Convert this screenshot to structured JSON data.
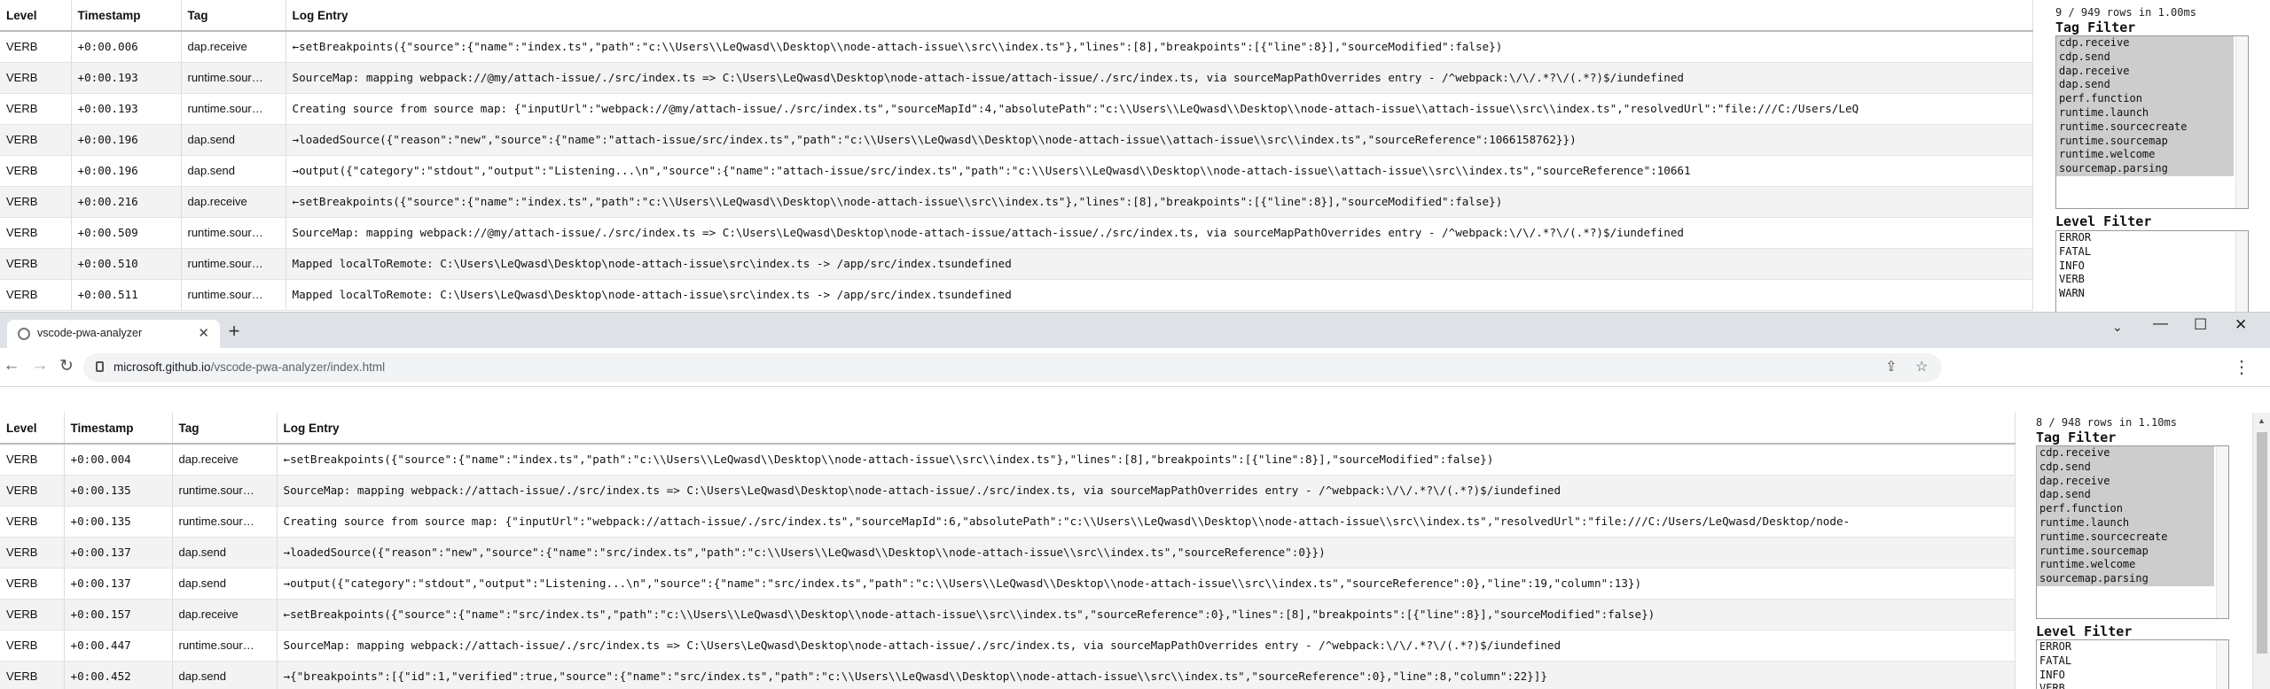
{
  "columns": [
    "Level",
    "Timestamp",
    "Tag",
    "Log Entry"
  ],
  "top": {
    "row_count": "9 / 949 rows in 1.00ms",
    "tag_filter_title": "Tag Filter",
    "tag_options": [
      "cdp.receive",
      "cdp.send",
      "dap.receive",
      "dap.send",
      "perf.function",
      "runtime.launch",
      "runtime.sourcecreate",
      "runtime.sourcemap",
      "runtime.welcome",
      "sourcemap.parsing"
    ],
    "level_filter_title": "Level Filter",
    "level_options": [
      "ERROR",
      "FATAL",
      "INFO",
      "VERB",
      "WARN"
    ],
    "rows": [
      {
        "level": "VERB",
        "ts": "+0:00.006",
        "tag": "dap.receive",
        "entry": "←setBreakpoints({\"source\":{\"name\":\"index.ts\",\"path\":\"c:\\\\Users\\\\LeQwasd\\\\Desktop\\\\node-attach-issue\\\\src\\\\index.ts\"},\"lines\":[8],\"breakpoints\":[{\"line\":8}],\"sourceModified\":false})"
      },
      {
        "level": "VERB",
        "ts": "+0:00.193",
        "tag": "runtime.sour…",
        "entry": "SourceMap: mapping webpack://@my/attach-issue/./src/index.ts => C:\\Users\\LeQwasd\\Desktop\\node-attach-issue/attach-issue/./src/index.ts, via sourceMapPathOverrides entry - /^webpack:\\/\\/.*?\\/(.*?)$/iundefined"
      },
      {
        "level": "VERB",
        "ts": "+0:00.193",
        "tag": "runtime.sour…",
        "entry": "Creating source from source map: {\"inputUrl\":\"webpack://@my/attach-issue/./src/index.ts\",\"sourceMapId\":4,\"absolutePath\":\"c:\\\\Users\\\\LeQwasd\\\\Desktop\\\\node-attach-issue\\\\attach-issue\\\\src\\\\index.ts\",\"resolvedUrl\":\"file:///C:/Users/LeQ"
      },
      {
        "level": "VERB",
        "ts": "+0:00.196",
        "tag": "dap.send",
        "entry": "→loadedSource({\"reason\":\"new\",\"source\":{\"name\":\"attach-issue/src/index.ts\",\"path\":\"c:\\\\Users\\\\LeQwasd\\\\Desktop\\\\node-attach-issue\\\\attach-issue\\\\src\\\\index.ts\",\"sourceReference\":1066158762}})"
      },
      {
        "level": "VERB",
        "ts": "+0:00.196",
        "tag": "dap.send",
        "entry": "→output({\"category\":\"stdout\",\"output\":\"Listening...\\n\",\"source\":{\"name\":\"attach-issue/src/index.ts\",\"path\":\"c:\\\\Users\\\\LeQwasd\\\\Desktop\\\\node-attach-issue\\\\attach-issue\\\\src\\\\index.ts\",\"sourceReference\":10661"
      },
      {
        "level": "VERB",
        "ts": "+0:00.216",
        "tag": "dap.receive",
        "entry": "←setBreakpoints({\"source\":{\"name\":\"index.ts\",\"path\":\"c:\\\\Users\\\\LeQwasd\\\\Desktop\\\\node-attach-issue\\\\src\\\\index.ts\"},\"lines\":[8],\"breakpoints\":[{\"line\":8}],\"sourceModified\":false})"
      },
      {
        "level": "VERB",
        "ts": "+0:00.509",
        "tag": "runtime.sour…",
        "entry": "SourceMap: mapping webpack://@my/attach-issue/./src/index.ts => C:\\Users\\LeQwasd\\Desktop\\node-attach-issue/attach-issue/./src/index.ts, via sourceMapPathOverrides entry - /^webpack:\\/\\/.*?\\/(.*?)$/iundefined"
      },
      {
        "level": "VERB",
        "ts": "+0:00.510",
        "tag": "runtime.sour…",
        "entry": "Mapped localToRemote: C:\\Users\\LeQwasd\\Desktop\\node-attach-issue\\src\\index.ts -> /app/src/index.tsundefined"
      },
      {
        "level": "VERB",
        "ts": "+0:00.511",
        "tag": "runtime.sour…",
        "entry": "Mapped localToRemote: C:\\Users\\LeQwasd\\Desktop\\node-attach-issue\\src\\index.ts -> /app/src/index.tsundefined"
      }
    ]
  },
  "browser": {
    "tab_title": "vscode-pwa-analyzer",
    "url_host": "microsoft.github.io",
    "url_path": "/vscode-pwa-analyzer/index.html"
  },
  "bottom": {
    "row_count": "8 / 948 rows in 1.10ms",
    "tag_filter_title": "Tag Filter",
    "tag_options": [
      "cdp.receive",
      "cdp.send",
      "dap.receive",
      "dap.send",
      "perf.function",
      "runtime.launch",
      "runtime.sourcecreate",
      "runtime.sourcemap",
      "runtime.welcome",
      "sourcemap.parsing"
    ],
    "level_filter_title": "Level Filter",
    "level_options": [
      "ERROR",
      "FATAL",
      "INFO",
      "VERB"
    ],
    "rows": [
      {
        "level": "VERB",
        "ts": "+0:00.004",
        "tag": "dap.receive",
        "entry": "←setBreakpoints({\"source\":{\"name\":\"index.ts\",\"path\":\"c:\\\\Users\\\\LeQwasd\\\\Desktop\\\\node-attach-issue\\\\src\\\\index.ts\"},\"lines\":[8],\"breakpoints\":[{\"line\":8}],\"sourceModified\":false})"
      },
      {
        "level": "VERB",
        "ts": "+0:00.135",
        "tag": "runtime.sour…",
        "entry": "SourceMap: mapping webpack://attach-issue/./src/index.ts => C:\\Users\\LeQwasd\\Desktop\\node-attach-issue/./src/index.ts, via sourceMapPathOverrides entry - /^webpack:\\/\\/.*?\\/(.*?)$/iundefined"
      },
      {
        "level": "VERB",
        "ts": "+0:00.135",
        "tag": "runtime.sour…",
        "entry": "Creating source from source map: {\"inputUrl\":\"webpack://attach-issue/./src/index.ts\",\"sourceMapId\":6,\"absolutePath\":\"c:\\\\Users\\\\LeQwasd\\\\Desktop\\\\node-attach-issue\\\\src\\\\index.ts\",\"resolvedUrl\":\"file:///C:/Users/LeQwasd/Desktop/node-"
      },
      {
        "level": "VERB",
        "ts": "+0:00.137",
        "tag": "dap.send",
        "entry": "→loadedSource({\"reason\":\"new\",\"source\":{\"name\":\"src/index.ts\",\"path\":\"c:\\\\Users\\\\LeQwasd\\\\Desktop\\\\node-attach-issue\\\\src\\\\index.ts\",\"sourceReference\":0}})"
      },
      {
        "level": "VERB",
        "ts": "+0:00.137",
        "tag": "dap.send",
        "entry": "→output({\"category\":\"stdout\",\"output\":\"Listening...\\n\",\"source\":{\"name\":\"src/index.ts\",\"path\":\"c:\\\\Users\\\\LeQwasd\\\\Desktop\\\\node-attach-issue\\\\src\\\\index.ts\",\"sourceReference\":0},\"line\":19,\"column\":13})"
      },
      {
        "level": "VERB",
        "ts": "+0:00.157",
        "tag": "dap.receive",
        "entry": "←setBreakpoints({\"source\":{\"name\":\"src/index.ts\",\"path\":\"c:\\\\Users\\\\LeQwasd\\\\Desktop\\\\node-attach-issue\\\\src\\\\index.ts\",\"sourceReference\":0},\"lines\":[8],\"breakpoints\":[{\"line\":8}],\"sourceModified\":false})"
      },
      {
        "level": "VERB",
        "ts": "+0:00.447",
        "tag": "runtime.sour…",
        "entry": "SourceMap: mapping webpack://attach-issue/./src/index.ts => C:\\Users\\LeQwasd\\Desktop\\node-attach-issue/./src/index.ts, via sourceMapPathOverrides entry - /^webpack:\\/\\/.*?\\/(.*?)$/iundefined"
      },
      {
        "level": "VERB",
        "ts": "+0:00.452",
        "tag": "dap.send",
        "entry": "→{\"breakpoints\":[{\"id\":1,\"verified\":true,\"source\":{\"name\":\"src/index.ts\",\"path\":\"c:\\\\Users\\\\LeQwasd\\\\Desktop\\\\node-attach-issue\\\\src\\\\index.ts\",\"sourceReference\":0},\"line\":8,\"column\":22}]}"
      }
    ]
  }
}
